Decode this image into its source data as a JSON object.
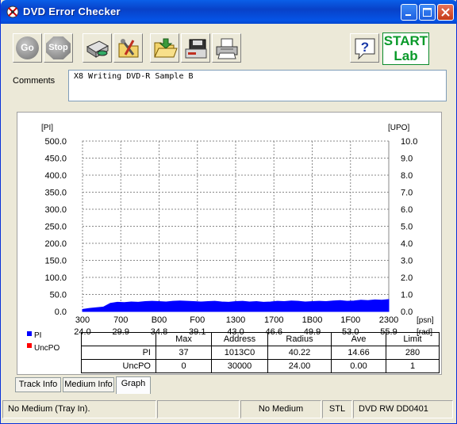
{
  "window": {
    "title": "DVD Error Checker"
  },
  "toolbar": {
    "go_label": "Go",
    "stop_label": "Stop",
    "logo_top": "START",
    "logo_bottom": "Lab",
    "icons": [
      "disc-drive-icon",
      "settings-tools-icon",
      "open-folder-icon",
      "save-disk-icon",
      "print-icon",
      "help-icon"
    ]
  },
  "comments": {
    "label": "Comments",
    "value": "X8 Writing DVD-R Sample B"
  },
  "chart_data": {
    "type": "area",
    "left_axis_label": "[PI]",
    "right_axis_label": "[UPO]",
    "left_ticks": [
      "500.0",
      "450.0",
      "400.0",
      "350.0",
      "300.0",
      "250.0",
      "200.0",
      "150.0",
      "100.0",
      "50.0",
      "0.0"
    ],
    "right_ticks": [
      "10.0",
      "9.0",
      "8.0",
      "7.0",
      "6.0",
      "5.0",
      "4.0",
      "3.0",
      "2.0",
      "1.0",
      "0.0"
    ],
    "ylim_left": [
      0,
      500
    ],
    "ylim_right": [
      0,
      10
    ],
    "x_ticks_psn": [
      "300",
      "700",
      "B00",
      "F00",
      "1300",
      "1700",
      "1B00",
      "1F00",
      "2300"
    ],
    "x_ticks_rad": [
      "24.0",
      "29.9",
      "34.8",
      "39.1",
      "43.0",
      "46.6",
      "49.9",
      "53.0",
      "55.9"
    ],
    "x_unit_psn": "[psn]",
    "x_unit_rad": "[rad]",
    "grid": true,
    "series": [
      {
        "name": "PI",
        "color": "#0000ff",
        "values": [
          6,
          9,
          11,
          13,
          24,
          27,
          26,
          28,
          27,
          29,
          30,
          29,
          28,
          30,
          31,
          30,
          29,
          28,
          29,
          30,
          28,
          27,
          29,
          30,
          28,
          29,
          27,
          28,
          30,
          29,
          31,
          30,
          28,
          29,
          30,
          29,
          31,
          32,
          30,
          31,
          33,
          32,
          34,
          33,
          35
        ]
      },
      {
        "name": "UncPO",
        "color": "#ff0000",
        "values": [
          0,
          0,
          0,
          0,
          0,
          0,
          0,
          0,
          0,
          0,
          0,
          0,
          0,
          0,
          0,
          0,
          0,
          0,
          0,
          0,
          0,
          0,
          0,
          0,
          0,
          0,
          0,
          0,
          0,
          0,
          0,
          0,
          0,
          0,
          0,
          0,
          0,
          0,
          0,
          0,
          0,
          0,
          0,
          0,
          0
        ]
      }
    ]
  },
  "stats": {
    "headers": [
      "Max",
      "Address",
      "Radius",
      "Ave",
      "Limit"
    ],
    "rows": [
      {
        "label": "PI",
        "cells": [
          "37",
          "1013C0",
          "40.22",
          "14.66",
          "280"
        ]
      },
      {
        "label": "UncPO",
        "cells": [
          "0",
          "30000",
          "24.00",
          "0.00",
          "1"
        ]
      }
    ]
  },
  "tabs": [
    "Track Info",
    "Medium Info",
    "Graph"
  ],
  "status_bar": [
    "No Medium (Tray In).",
    "",
    "No Medium",
    "STL",
    "DVD RW DD0401"
  ]
}
